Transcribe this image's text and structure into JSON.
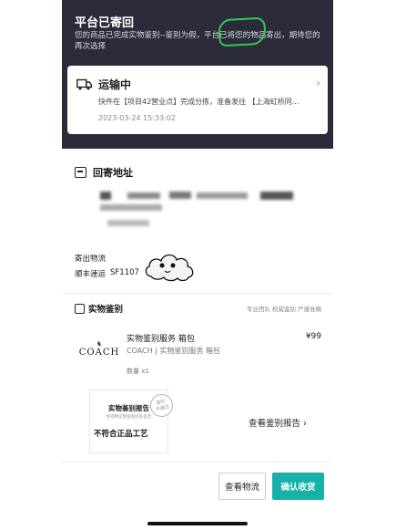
{
  "header": {
    "title": "平台已寄回",
    "description": "您的商品已完成实物鉴别--鉴别为假，平台已将您的物品寄出，期待您的再次选择"
  },
  "shipping": {
    "status": "运输中",
    "detail": "快件在【项目42营业点】完成分拣，准备发往 【上海虹桥同...",
    "time": "2023-03-24 15:33:02"
  },
  "address": {
    "title": "回寄地址"
  },
  "logistics": {
    "label": "寄出物流",
    "carrier": "顺丰速运",
    "tracking": "SF1107"
  },
  "appraisal": {
    "title": "实物鉴别",
    "tags": "专业团队  权威鉴别  严谨准确",
    "product": {
      "brand_logo_text": "COACH",
      "name": "实物鉴别服务 箱包",
      "subtitle": "COACH | 实物鉴别服务 箱包",
      "price": "¥99",
      "qty": "数量 x1"
    },
    "report": {
      "title": "实物鉴别报告",
      "subtitle": "经得物实物鉴别团队鉴定",
      "verdict": "不符合正品工艺",
      "stamp": "鉴别\n不通过",
      "link_label": "查看鉴别报告"
    }
  },
  "actions": {
    "view_logistics": "查看物流",
    "confirm_receipt": "确认收货"
  },
  "colors": {
    "header_bg": "#2b2b3a",
    "accent": "#16b2a9",
    "highlight_mark": "#34c759"
  }
}
